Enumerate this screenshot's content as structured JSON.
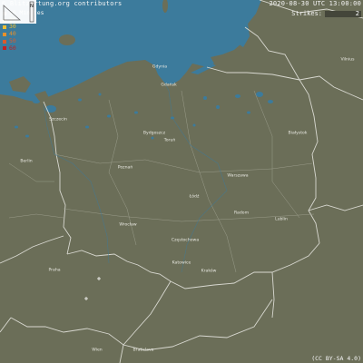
{
  "header": {
    "credit": "© Blitzortung.org contributors",
    "timestamp": "2020-08-30 UTC 13:00:00",
    "strikes_label": "Strikes:",
    "strikes_value": "2"
  },
  "legend": {
    "items": [
      {
        "label": "10 Minutes",
        "color": "#f4f4f4"
      },
      {
        "label": "20",
        "color": "#f1e64a"
      },
      {
        "label": "30",
        "color": "#eebf32"
      },
      {
        "label": "40",
        "color": "#e8902a"
      },
      {
        "label": "50",
        "color": "#dd5a2a"
      },
      {
        "label": "60",
        "color": "#c32020"
      }
    ]
  },
  "license": "(CC BY-SA 4.0)",
  "scale": {
    "north_label": "N"
  },
  "cities": {
    "gdansk": "Gdańsk",
    "gdynia": "Gdynia",
    "vilnius": "Vilnius",
    "szczecin": "Szczecin",
    "bydgoszcz": "Bydgoszcz",
    "torun": "Toruń",
    "bialystok": "Białystok",
    "berlin": "Berlin",
    "poznan": "Poznań",
    "warszawa": "Warszawa",
    "lodz": "Łódź",
    "radom": "Radom",
    "lublin": "Lublin",
    "wroclaw": "Wrocław",
    "czestochowa": "Częstochowa",
    "katowice": "Katowice",
    "krakow": "Kraków",
    "praha": "Praha",
    "wien": "Wien",
    "bratislava": "Bratislava"
  },
  "colors": {
    "land": "#6b6e58",
    "sea": "#3c7b9c",
    "lakes": "#3c7b9c",
    "borders": "#d8d8d0"
  },
  "strike_markers": [
    {
      "name": "strike-1",
      "color": "#ffffff"
    },
    {
      "name": "strike-2",
      "color": "#ffffff"
    }
  ]
}
